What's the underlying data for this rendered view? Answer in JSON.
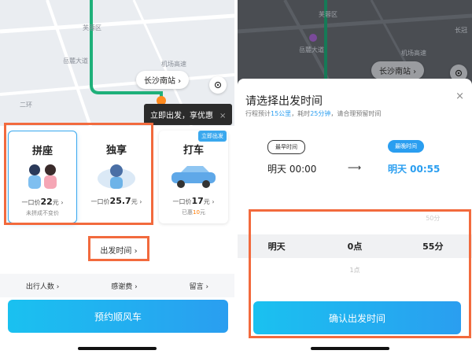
{
  "left": {
    "map": {
      "labels": [
        "芙蓉区",
        "岳麓大道",
        "机场高速",
        "长沙南站",
        "二环"
      ],
      "station": "长沙南站 ›"
    },
    "tooltip": {
      "text": "立即出发，享优惠",
      "close": "×"
    },
    "badge": "立即出发",
    "cards": [
      {
        "title": "拼座",
        "price_prefix": "一口价",
        "price": "22",
        "price_unit": "元 ›",
        "note": "未拼成不变价"
      },
      {
        "title": "独享",
        "price_prefix": "一口价",
        "price": "25.7",
        "price_unit": "元 ›",
        "note": ""
      },
      {
        "title": "打车",
        "price_prefix": "一口价",
        "price": "17",
        "price_unit": "元 ›",
        "note_prefix": "已惠",
        "note_highlight": "10",
        "note_suffix": "元"
      }
    ],
    "depart_time_label": "出发时间 ›",
    "options": [
      "出行人数 ›",
      "感谢费 ›",
      "留言 ›"
    ],
    "book_button": "预约顺风车"
  },
  "right": {
    "map": {
      "labels": [
        "芙蓉区",
        "岳麓大道",
        "机场高速",
        "长沙南站",
        "长冠"
      ],
      "station": "长沙南站 ›"
    },
    "sheet": {
      "title": "请选择出发时间",
      "close": "×",
      "sub_prefix": "行程预计",
      "distance": "15公里",
      "sub_mid": "，耗时",
      "duration": "25分钟",
      "sub_suffix": "，请合理预留时间",
      "earliest_tag": "最早时间",
      "earliest_value": "明天 00:00",
      "arrow": "⟶",
      "latest_tag": "最晚时间",
      "latest_value": "明天 00:55"
    },
    "picker": {
      "above": [
        "",
        "",
        "50分"
      ],
      "selected": [
        "明天",
        "0点",
        "55分"
      ],
      "below": [
        "",
        "1点",
        ""
      ]
    },
    "confirm_button": "确认出发时间"
  },
  "colors": {
    "accent": "#2a9ef0",
    "highlight": "#f26a3d",
    "route": "#1fb07a"
  }
}
